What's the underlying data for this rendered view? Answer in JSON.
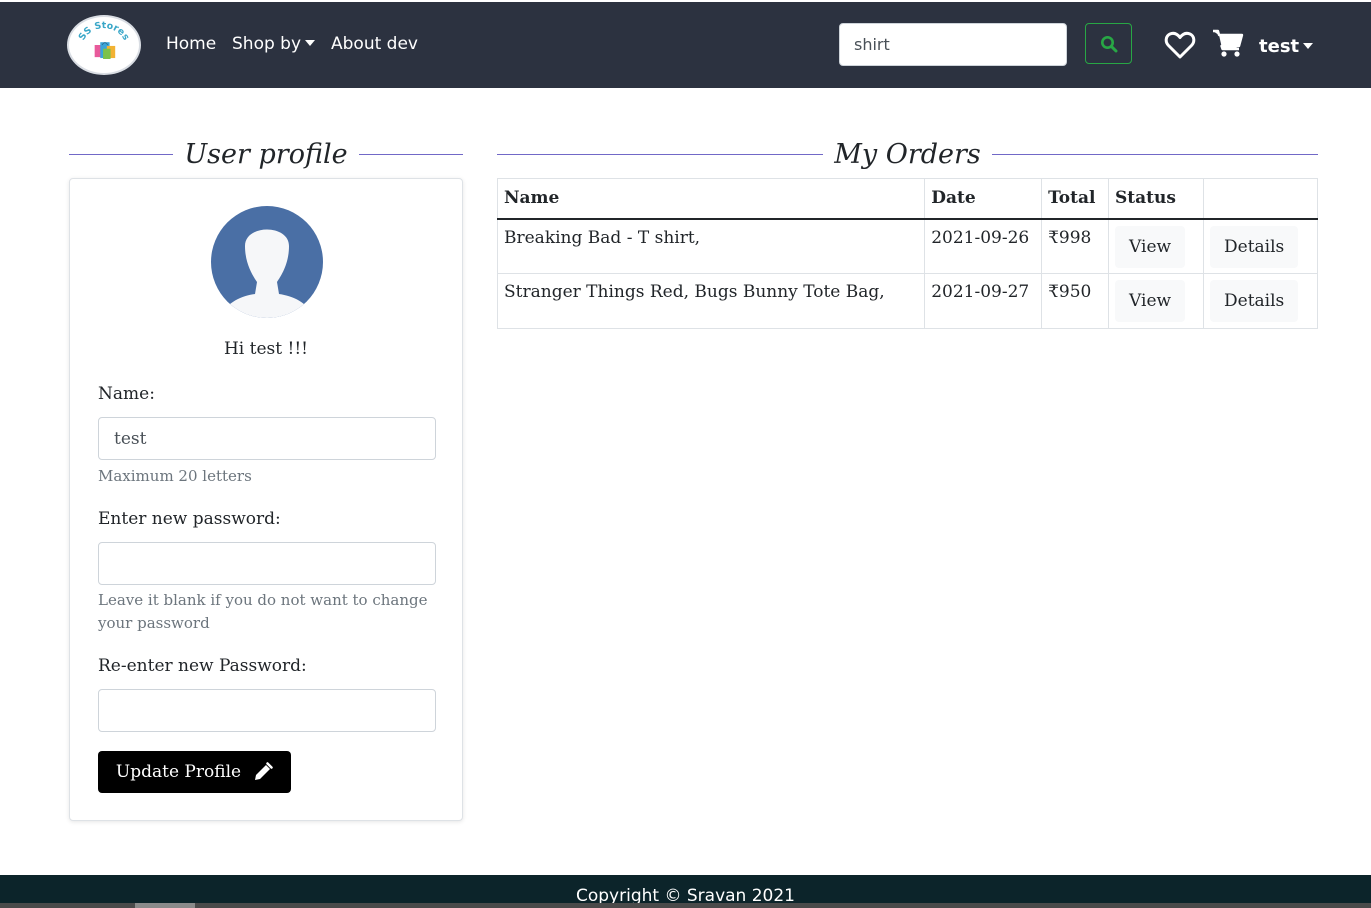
{
  "header": {
    "logo_text": "SS Stores",
    "nav": [
      {
        "label": "Home"
      },
      {
        "label": "Shop by"
      },
      {
        "label": "About dev"
      }
    ],
    "search": {
      "value": "shirt",
      "placeholder": ""
    },
    "user": {
      "label": "test"
    },
    "icons": {
      "search": "search-icon",
      "wishlist": "heart-icon",
      "cart": "cart-icon"
    }
  },
  "profile": {
    "section_title": "User profile",
    "greeting": "Hi test !!!",
    "name_label": "Name:",
    "name_value": "test",
    "name_hint": "Maximum 20 letters",
    "password_label": "Enter new password:",
    "password_hint": "Leave it blank if you do not want to change your password",
    "confirm_label": "Re-enter new Password:",
    "update_button": "Update Profile"
  },
  "orders": {
    "section_title": "My Orders",
    "columns": [
      "Name",
      "Date",
      "Total",
      "Status",
      ""
    ],
    "rows": [
      {
        "name": "Breaking Bad - T shirt,",
        "date": "2021-09-26",
        "total": "₹998",
        "status_btn": "View",
        "details_btn": "Details"
      },
      {
        "name": "Stranger Things Red, Bugs Bunny Tote Bag,",
        "date": "2021-09-27",
        "total": "₹950",
        "status_btn": "View",
        "details_btn": "Details"
      }
    ]
  },
  "footer": {
    "copyright": "Copyright © Sravan 2021"
  },
  "colors": {
    "navbar": "#2c3240",
    "accent_rule": "#7168c7",
    "search_green": "#28a745",
    "footer": "#0c242a",
    "avatar_blue": "#4a6fa5"
  }
}
